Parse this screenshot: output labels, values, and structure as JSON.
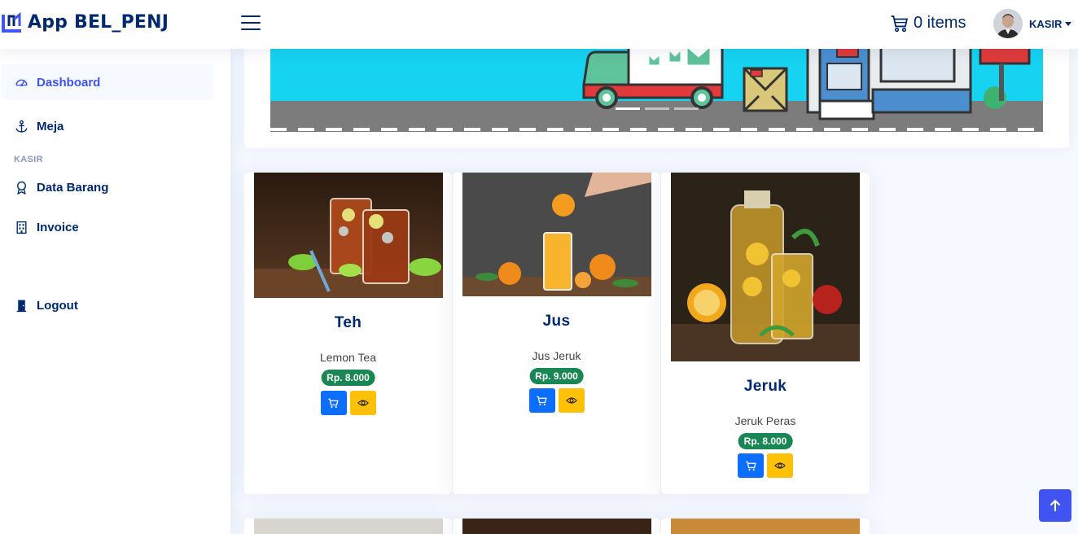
{
  "header": {
    "app_name": "App BEL_PENJ",
    "cart_text": "0 items",
    "user_name": "KASIR"
  },
  "sidebar": {
    "items": [
      {
        "label": "Dashboard",
        "icon": "speedometer-icon"
      },
      {
        "label": "Meja",
        "icon": "anchor-icon"
      },
      {
        "label": "Data Barang",
        "icon": "award-icon"
      },
      {
        "label": "Invoice",
        "icon": "building-icon"
      },
      {
        "label": "Logout",
        "icon": "door-icon"
      }
    ],
    "heading": "KASIR"
  },
  "products": [
    {
      "name": "Teh",
      "description": "Lemon Tea",
      "price": "Rp. 8.000"
    },
    {
      "name": "Jus",
      "description": "Jus Jeruk",
      "price": "Rp. 9.000"
    },
    {
      "name": "Jeruk",
      "description": "Jeruk Peras",
      "price": "Rp. 8.000"
    }
  ],
  "colors": {
    "primary": "#012970",
    "accent": "#4154f1",
    "price_badge": "#198754",
    "cart_button": "#0d6efd",
    "view_button": "#ffc107",
    "background": "#f6f9ff"
  }
}
